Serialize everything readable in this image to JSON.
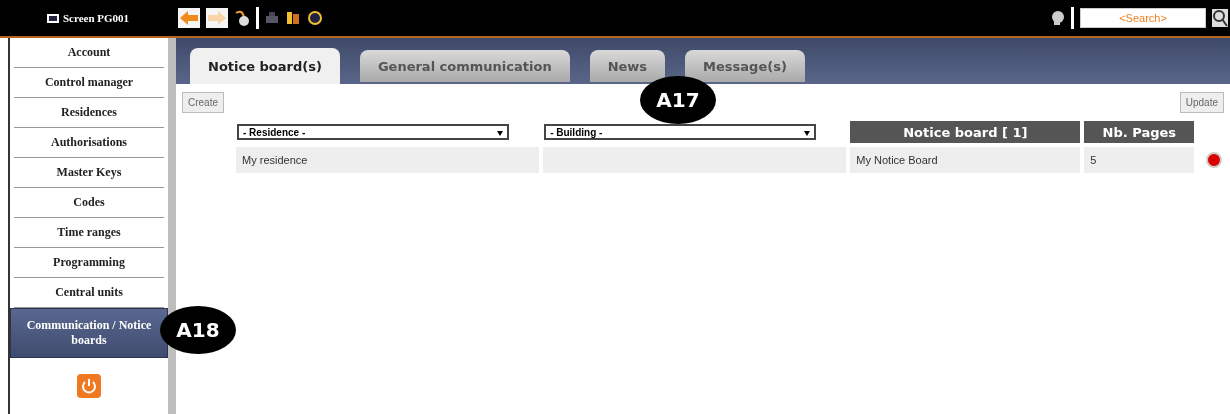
{
  "topbar": {
    "screen_label": "Screen PG001",
    "search": {
      "placeholder": "<Search>"
    }
  },
  "sidebar": {
    "items": [
      {
        "label": "Account",
        "selected": false
      },
      {
        "label": "Control manager",
        "selected": false
      },
      {
        "label": "Residences",
        "selected": false
      },
      {
        "label": "Authorisations",
        "selected": false
      },
      {
        "label": "Master Keys",
        "selected": false
      },
      {
        "label": "Codes",
        "selected": false
      },
      {
        "label": "Time ranges",
        "selected": false
      },
      {
        "label": "Programming",
        "selected": false
      },
      {
        "label": "Central units",
        "selected": false
      },
      {
        "label": "Communication / Notice boards",
        "selected": true
      }
    ]
  },
  "tabs": [
    {
      "label": "Notice board(s)",
      "selected": true
    },
    {
      "label": "General communication",
      "selected": false
    },
    {
      "label": "News",
      "selected": false
    },
    {
      "label": "Message(s)",
      "selected": false
    }
  ],
  "toolbar": {
    "create": "Create",
    "update": "Update"
  },
  "table": {
    "columns": [
      {
        "kind": "select",
        "label": "- Residence -"
      },
      {
        "kind": "select",
        "label": "- Building -"
      },
      {
        "kind": "header",
        "label": "Notice board [ 1]"
      },
      {
        "kind": "header",
        "label": "Nb. Pages"
      }
    ],
    "rows": [
      {
        "cells": [
          "My residence",
          "",
          "My Notice Board",
          "5"
        ],
        "color": "#dd0000"
      }
    ]
  },
  "callouts": [
    {
      "label": "A17"
    },
    {
      "label": "A18"
    }
  ]
}
